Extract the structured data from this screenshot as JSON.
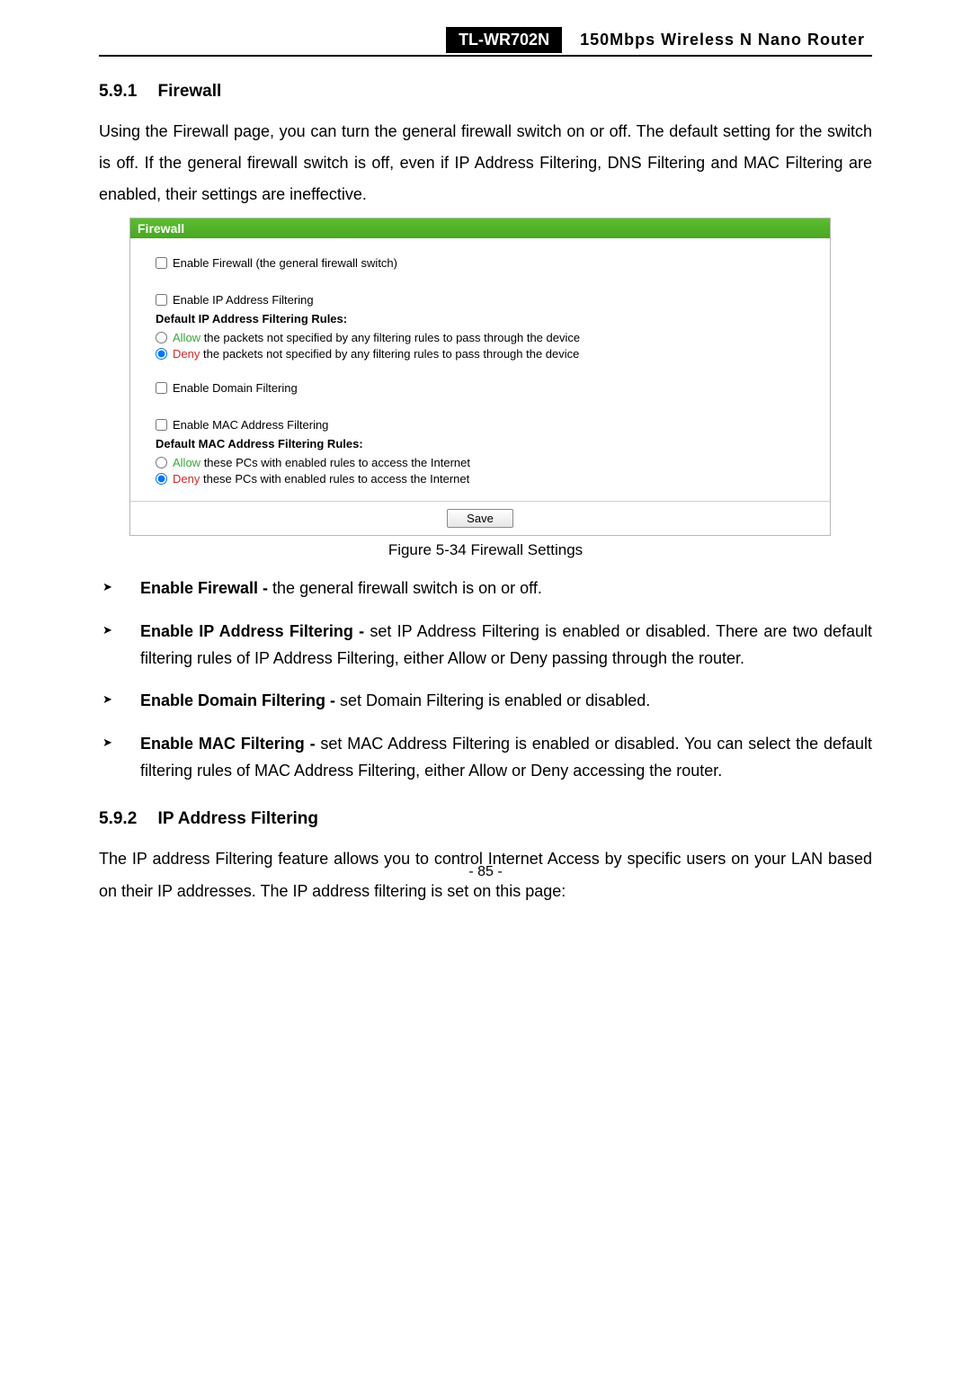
{
  "header": {
    "model": "TL-WR702N",
    "title": "150Mbps Wireless N Nano Router"
  },
  "sect1": {
    "number": "5.9.1",
    "title": "Firewall",
    "para": "Using the Firewall page, you can turn the general firewall switch on or off. The default setting for the switch is off. If the general firewall switch is off, even if IP Address Filtering, DNS Filtering and MAC Filtering are enabled, their settings are ineffective."
  },
  "fw": {
    "panel_title": "Firewall",
    "enable_fw": "Enable Firewall (the general firewall switch)",
    "enable_ip": "Enable IP Address Filtering",
    "ip_rules_head": "Default IP Address Filtering Rules:",
    "ip_allow_kw": "Allow",
    "ip_allow_tail": " the packets not specified by any filtering rules to pass through the device",
    "ip_deny_kw": "Deny",
    "ip_deny_tail": " the packets not specified by any filtering rules to pass through the device",
    "enable_domain": "Enable Domain Filtering",
    "enable_mac": "Enable MAC Address Filtering",
    "mac_rules_head": "Default MAC Address Filtering Rules:",
    "mac_allow_kw": "Allow",
    "mac_allow_tail": " these PCs with enabled rules to access the Internet",
    "mac_deny_kw": "Deny",
    "mac_deny_tail": " these PCs with enabled rules to access the Internet",
    "save": "Save",
    "caption": "Figure 5-34 Firewall Settings"
  },
  "bullets": {
    "b1_term": "Enable Firewall -",
    "b1_tail": " the general firewall switch is on or off.",
    "b2_term": "Enable IP Address Filtering -",
    "b2_tail": " set IP Address Filtering is enabled or disabled. There are two default filtering rules of IP Address Filtering, either Allow or Deny passing through the router.",
    "b3_term": "Enable Domain Filtering -",
    "b3_tail": " set Domain Filtering is enabled or disabled.",
    "b4_term": "Enable MAC Filtering -",
    "b4_tail": " set MAC Address Filtering is enabled or disabled. You can select the default filtering rules of MAC Address Filtering, either Allow or Deny accessing the router."
  },
  "sect2": {
    "number": "5.9.2",
    "title": "IP Address Filtering",
    "para": "The IP address Filtering feature allows you to control Internet Access by specific users on your LAN based on their IP addresses. The IP address filtering is set on this page:"
  },
  "footer": {
    "page": "- 85 -"
  }
}
